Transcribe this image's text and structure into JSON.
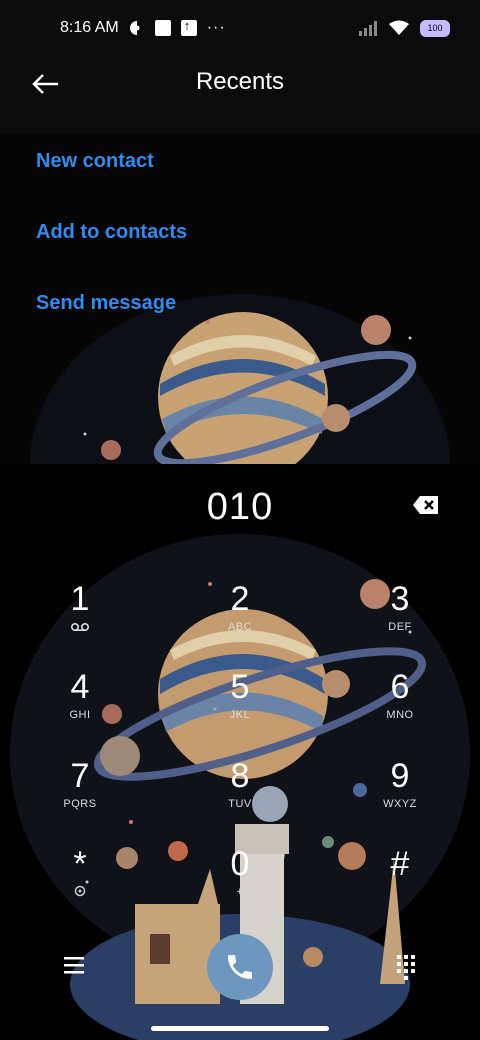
{
  "status_bar": {
    "time": "8:16 AM",
    "overflow": "···",
    "battery": "100",
    "icons": [
      "theme-icon",
      "square-icon",
      "upload-icon",
      "signal-icon",
      "wifi-icon",
      "battery-icon"
    ]
  },
  "header": {
    "title": "Recents",
    "back_icon": "back-arrow-icon"
  },
  "menu": {
    "items": [
      {
        "label": "New contact"
      },
      {
        "label": "Add to contacts"
      },
      {
        "label": "Send message"
      }
    ]
  },
  "dialer": {
    "number": "010",
    "backspace_icon": "backspace-icon",
    "keys": [
      {
        "digit": "1",
        "letters": "",
        "icon": "voicemail-icon"
      },
      {
        "digit": "2",
        "letters": "ABC"
      },
      {
        "digit": "3",
        "letters": "DEF"
      },
      {
        "digit": "4",
        "letters": "GHI"
      },
      {
        "digit": "5",
        "letters": "JKL"
      },
      {
        "digit": "6",
        "letters": "MNO"
      },
      {
        "digit": "7",
        "letters": "PQRS"
      },
      {
        "digit": "8",
        "letters": "TUV"
      },
      {
        "digit": "9",
        "letters": "WXYZ"
      },
      {
        "digit": "*",
        "letters": ""
      },
      {
        "digit": "0",
        "letters": "+"
      },
      {
        "digit": "#",
        "letters": ""
      }
    ]
  },
  "bottom_bar": {
    "menu_icon": "hamburger-menu-icon",
    "call_icon": "phone-icon",
    "dialpad_icon": "dialpad-icon"
  },
  "colors": {
    "accent": "#2f8cf0",
    "call_button": "#6e97bf",
    "battery": "#c7b9ff"
  }
}
